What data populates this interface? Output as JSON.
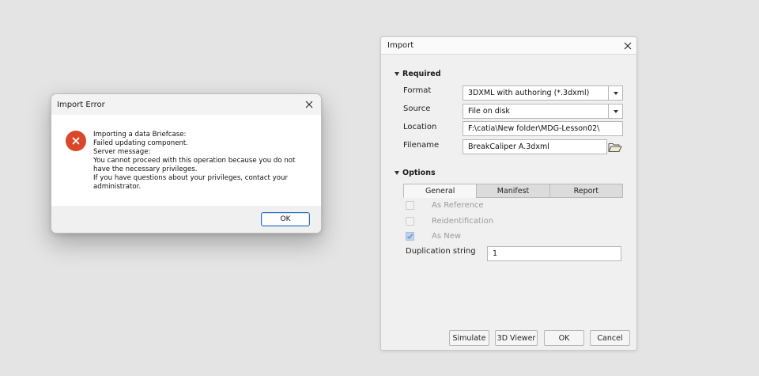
{
  "error_dialog": {
    "title": "Import Error",
    "lines": [
      "Importing a data Briefcase:",
      "Failed updating component.",
      "Server message:",
      "You cannot proceed with this operation because you do not",
      "have the necessary privileges.",
      "If you have questions about your privileges, contact your",
      "administrator."
    ],
    "ok_label": "OK"
  },
  "import_dialog": {
    "title": "Import",
    "required_label": "Required",
    "format_label": "Format",
    "format_value": "3DXML with authoring (*.3dxml)",
    "source_label": "Source",
    "source_value": "File on disk",
    "location_label": "Location",
    "location_value": "F:\\catia\\New folder\\MDG-Lesson02\\",
    "filename_label": "Filename",
    "filename_value": "BreakCaliper A.3dxml",
    "options_label": "Options",
    "tabs": [
      "General",
      "Manifest",
      "Report"
    ],
    "as_reference_label": "As Reference",
    "reidentification_label": "Reidentification",
    "as_new_label": "As New",
    "duplication_label": "Duplication string",
    "duplication_value": "1",
    "buttons": {
      "simulate": "Simulate",
      "viewer": "3D Viewer",
      "ok": "OK",
      "cancel": "Cancel"
    }
  },
  "colors": {
    "background": "#e4e4e4",
    "error_icon": "#d9482b",
    "focus_border": "#2d6cc0",
    "checked_fill": "#bcd2ea"
  },
  "icons": [
    "close-icon",
    "error-icon",
    "folder-open-icon",
    "collapse-triangle-icon",
    "dropdown-arrow-icon",
    "checkmark-icon"
  ]
}
